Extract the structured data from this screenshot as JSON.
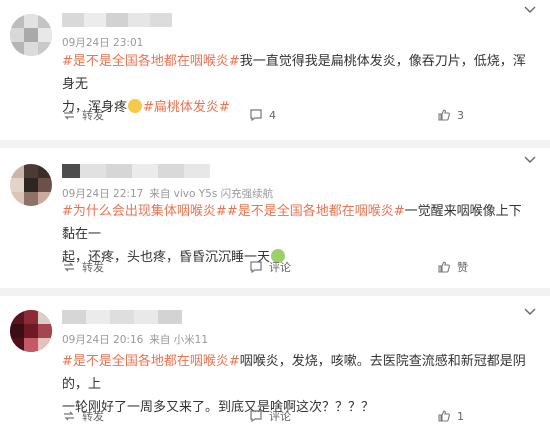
{
  "posts": [
    {
      "meta": {
        "time": "09月24日 23:01",
        "source": ""
      },
      "tags_start": [
        "#是不是全国各地都在咽喉炎#"
      ],
      "text_1": "我一直觉得我是扁桃体发炎，像吞刀片，低烧，浑身无",
      "text_2": "力，浑身疼",
      "tag_end": "#扁桃体发炎#",
      "actions": {
        "repost": "转发",
        "comment": "4",
        "like": "3"
      }
    },
    {
      "meta": {
        "time": "09月24日 22:17",
        "source": "来自 vivo Y5s 闪充强续航"
      },
      "tag_a": "#为什么会出现集体咽喉炎#",
      "tag_b": "#是不是全国各地都在咽喉炎#",
      "text_1": "一觉醒来咽喉像上下黏在一",
      "text_2": "起，还疼，头也疼，昏昏沉沉睡一天",
      "actions": {
        "repost": "转发",
        "comment": "评论",
        "like": "赞"
      }
    },
    {
      "meta": {
        "time": "09月24日 20:16",
        "source": "来自 小米11"
      },
      "tag_a": "#是不是全国各地都在咽喉炎#",
      "text_1": "咽喉炎，发烧，咳嗽。去医院查流感和新冠都是阴的，上",
      "text_2": "一轮刚好了一周多又来了。到底又是啥啊这次？？？？",
      "actions": {
        "repost": "转发",
        "comment": "评论",
        "like": "1"
      }
    }
  ]
}
